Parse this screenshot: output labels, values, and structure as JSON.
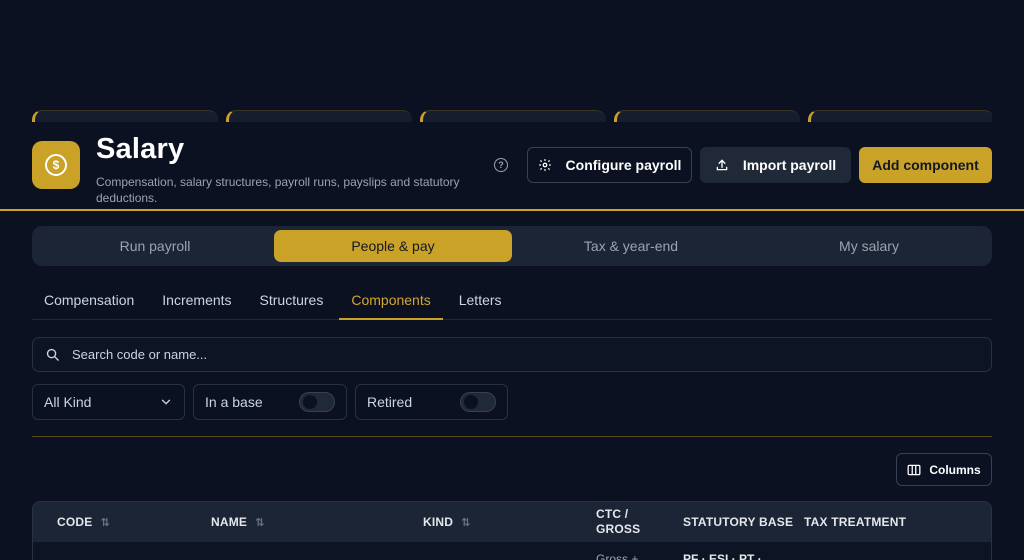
{
  "header": {
    "title": "Salary",
    "subtitle": "Compensation, salary structures, payroll runs, payslips and statutory deductions.",
    "icons": {
      "logo": "dollar-circle-icon",
      "help": "help-circle-icon"
    }
  },
  "actions": {
    "configure_label": "Configure payroll",
    "import_label": "Import payroll",
    "add_label": "Add component"
  },
  "main_tabs": [
    {
      "label": "Run payroll",
      "active": false
    },
    {
      "label": "People & pay",
      "active": true
    },
    {
      "label": "Tax & year-end",
      "active": false
    },
    {
      "label": "My salary",
      "active": false
    }
  ],
  "sub_tabs": [
    {
      "label": "Compensation",
      "active": false
    },
    {
      "label": "Increments",
      "active": false
    },
    {
      "label": "Structures",
      "active": false
    },
    {
      "label": "Components",
      "active": true
    },
    {
      "label": "Letters",
      "active": false
    }
  ],
  "search": {
    "placeholder": "Search code or name..."
  },
  "filters": {
    "kind_value": "All Kind",
    "in_base_label": "In a base",
    "in_base_on": false,
    "retired_label": "Retired",
    "retired_on": false
  },
  "columns_button": "Columns",
  "table": {
    "headers": {
      "code": "CODE",
      "name": "NAME",
      "kind": "KIND",
      "ctc_line1": "CTC /",
      "ctc_line2": "GROSS",
      "statutory": "STATUTORY BASE",
      "tax": "TAX TREATMENT"
    },
    "first_row": {
      "ctc": "Gross +",
      "statutory": "PF · ESI · PT ·"
    }
  },
  "colors": {
    "accent": "#c9a227",
    "background": "#0b1120",
    "panel": "#1b2536"
  }
}
